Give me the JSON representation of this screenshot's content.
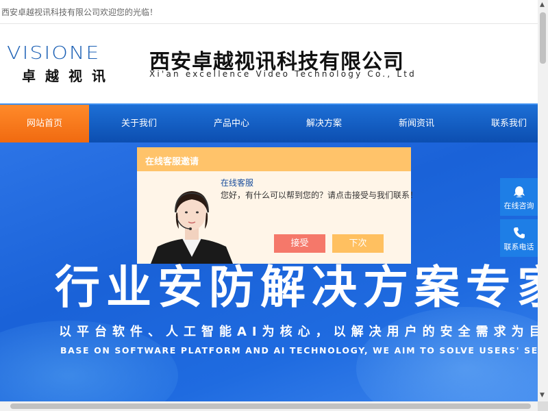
{
  "topbar": {
    "text": "西安卓越视讯科技有限公司欢迎您的光临！"
  },
  "logo": {
    "en": "VISIONE",
    "cn": "卓越视讯"
  },
  "company": {
    "cn": "西安卓越视讯科技有限公司",
    "en": "Xi'an excellence Video Technology Co., Ltd"
  },
  "nav": {
    "items": [
      {
        "label": "网站首页"
      },
      {
        "label": "关于我们"
      },
      {
        "label": "产品中心"
      },
      {
        "label": "解决方案"
      },
      {
        "label": "新闻资讯"
      },
      {
        "label": "联系我们"
      }
    ]
  },
  "hero": {
    "title": "行业安防解决方案专家",
    "subtitle": "以平台软件、人工智能AI为核心，以解决用户的安全需求为目标",
    "english": "BASE ON SOFTWARE PLATFORM AND AI TECHNOLOGY, WE AIM TO SOLVE USERS' SECURITY NEEDS"
  },
  "popup": {
    "header": "在线客服邀请",
    "name": "在线客服",
    "message": "您好，有什么可以帮到您的？请点击接受与我们联系！",
    "accept": "接受",
    "next": "下次"
  },
  "side": {
    "qq": "在线咨询",
    "phone": "联系电话"
  },
  "colors": {
    "nav": "#0c4eb0",
    "active": "#f06a10",
    "popup_header": "#ffc36a",
    "accept": "#f5786a",
    "next": "#ffc060",
    "side": "#1e7ee6"
  }
}
